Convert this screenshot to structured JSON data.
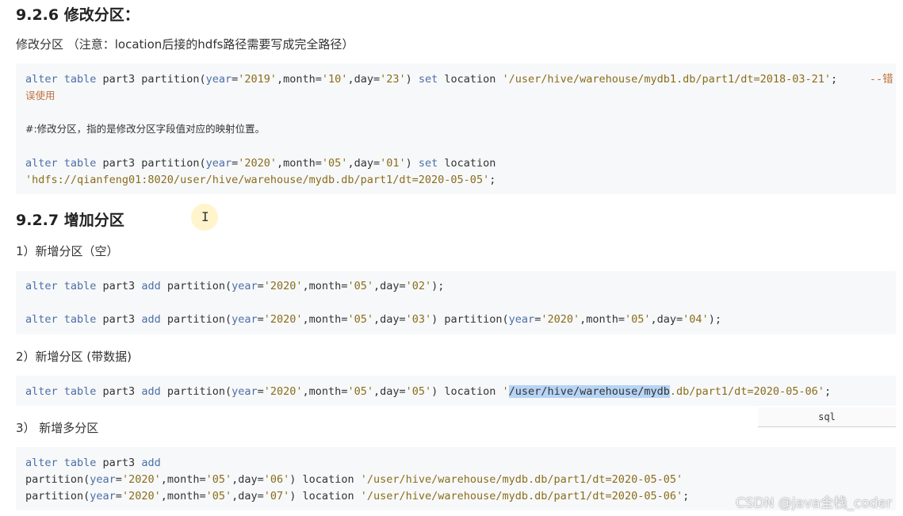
{
  "sections": {
    "s926": {
      "heading": "9.2.6 修改分区：",
      "note": "修改分区 （注意：location后接的hdfs路径需要写成完全路径）",
      "code": {
        "l1_kw1": "alter table",
        "l1_t1": " part3 partition(",
        "l1_kw2": "year",
        "l1_t2": "=",
        "l1_s1": "'2019'",
        "l1_t3": ",month=",
        "l1_s2": "'10'",
        "l1_t4": ",day=",
        "l1_s3": "'23'",
        "l1_t5": ") ",
        "l1_kw3": "set",
        "l1_t6": " location ",
        "l1_s4": "'/user/hive/warehouse/mydb1.db/part1/dt=2018-03-21'",
        "l1_t7": ";     ",
        "l1_c1": "--错",
        "l2_c": "误使用",
        "l3_comment": "#:修改分区，指的是修改分区字段值对应的映射位置。",
        "l4_kw1": "alter table",
        "l4_t1": " part3 partition(",
        "l4_kw2": "year",
        "l4_t2": "=",
        "l4_s1": "'2020'",
        "l4_t3": ",month=",
        "l4_s2": "'05'",
        "l4_t4": ",day=",
        "l4_s3": "'01'",
        "l4_t5": ") ",
        "l4_kw3": "set",
        "l4_t6": " location",
        "l5_s": "'hdfs://qianfeng01:8020/user/hive/warehouse/mydb.db/part1/dt=2020-05-05'",
        "l5_t": ";"
      }
    },
    "s927": {
      "heading": "9.2.7 增加分区",
      "sub1": "1）新增分区（空）",
      "code1": {
        "a_kw1": "alter table",
        "a_t1": " part3 ",
        "a_kw2": "add",
        "a_t2": " partition(",
        "a_kw3": "year",
        "a_t3": "=",
        "a_s1": "'2020'",
        "a_t4": ",month=",
        "a_s2": "'05'",
        "a_t5": ",day=",
        "a_s3": "'02'",
        "a_t6": ");",
        "b_kw1": "alter table",
        "b_t1": " part3 ",
        "b_kw2": "add",
        "b_t2": " partition(",
        "b_kw3": "year",
        "b_t3": "=",
        "b_s1": "'2020'",
        "b_t4": ",month=",
        "b_s2": "'05'",
        "b_t5": ",day=",
        "b_s3": "'03'",
        "b_t6": ") partition(",
        "b_kw4": "year",
        "b_t7": "=",
        "b_s4": "'2020'",
        "b_t8": ",month=",
        "b_s5": "'05'",
        "b_t9": ",day=",
        "b_s6": "'04'",
        "b_t10": ");"
      },
      "sub2": "2）新增分区 (带数据)",
      "code2": {
        "kw1": "alter table",
        "t1": " part3 ",
        "kw2": "add",
        "t2": " partition(",
        "kw3": "year",
        "t3": "=",
        "s1": "'2020'",
        "t4": ",month=",
        "s2": "'05'",
        "t5": ",day=",
        "s3": "'05'",
        "t6": ") location ",
        "s4a": "'",
        "s4hl": "/user/hive/warehouse/mydb",
        "s4b": ".db/part1/dt=2020-05-06'",
        "t7": ";"
      },
      "lang_tab": "sql",
      "sub3": "3） 新增多分区",
      "code3": {
        "a_kw1": "alter table",
        "a_t1": " part3 ",
        "a_kw2": "add",
        "b_t1": "partition(",
        "b_kw1": "year",
        "b_t2": "=",
        "b_s1": "'2020'",
        "b_t3": ",month=",
        "b_s2": "'05'",
        "b_t4": ",day=",
        "b_s3": "'06'",
        "b_t5": ") location ",
        "b_s4": "'/user/hive/warehouse/mydb.db/part1/dt=2020-05-05'",
        "c_t1": "partition(",
        "c_kw1": "year",
        "c_t2": "=",
        "c_s1": "'2020'",
        "c_t3": ",month=",
        "c_s2": "'05'",
        "c_t4": ",day=",
        "c_s3": "'07'",
        "c_t5": ") location ",
        "c_s4": "'/user/hive/warehouse/mydb.db/part1/dt=2020-05-06'",
        "c_t6": ";"
      }
    }
  },
  "watermark": "CSDN @java全栈_coder",
  "cursor_glyph": "I",
  "colors": {
    "keyword": "#4a6fa5",
    "string": "#8a6d1a",
    "comment": "#c0703a",
    "code_bg": "#f7f8fa",
    "highlight": "#b7d4f5"
  }
}
